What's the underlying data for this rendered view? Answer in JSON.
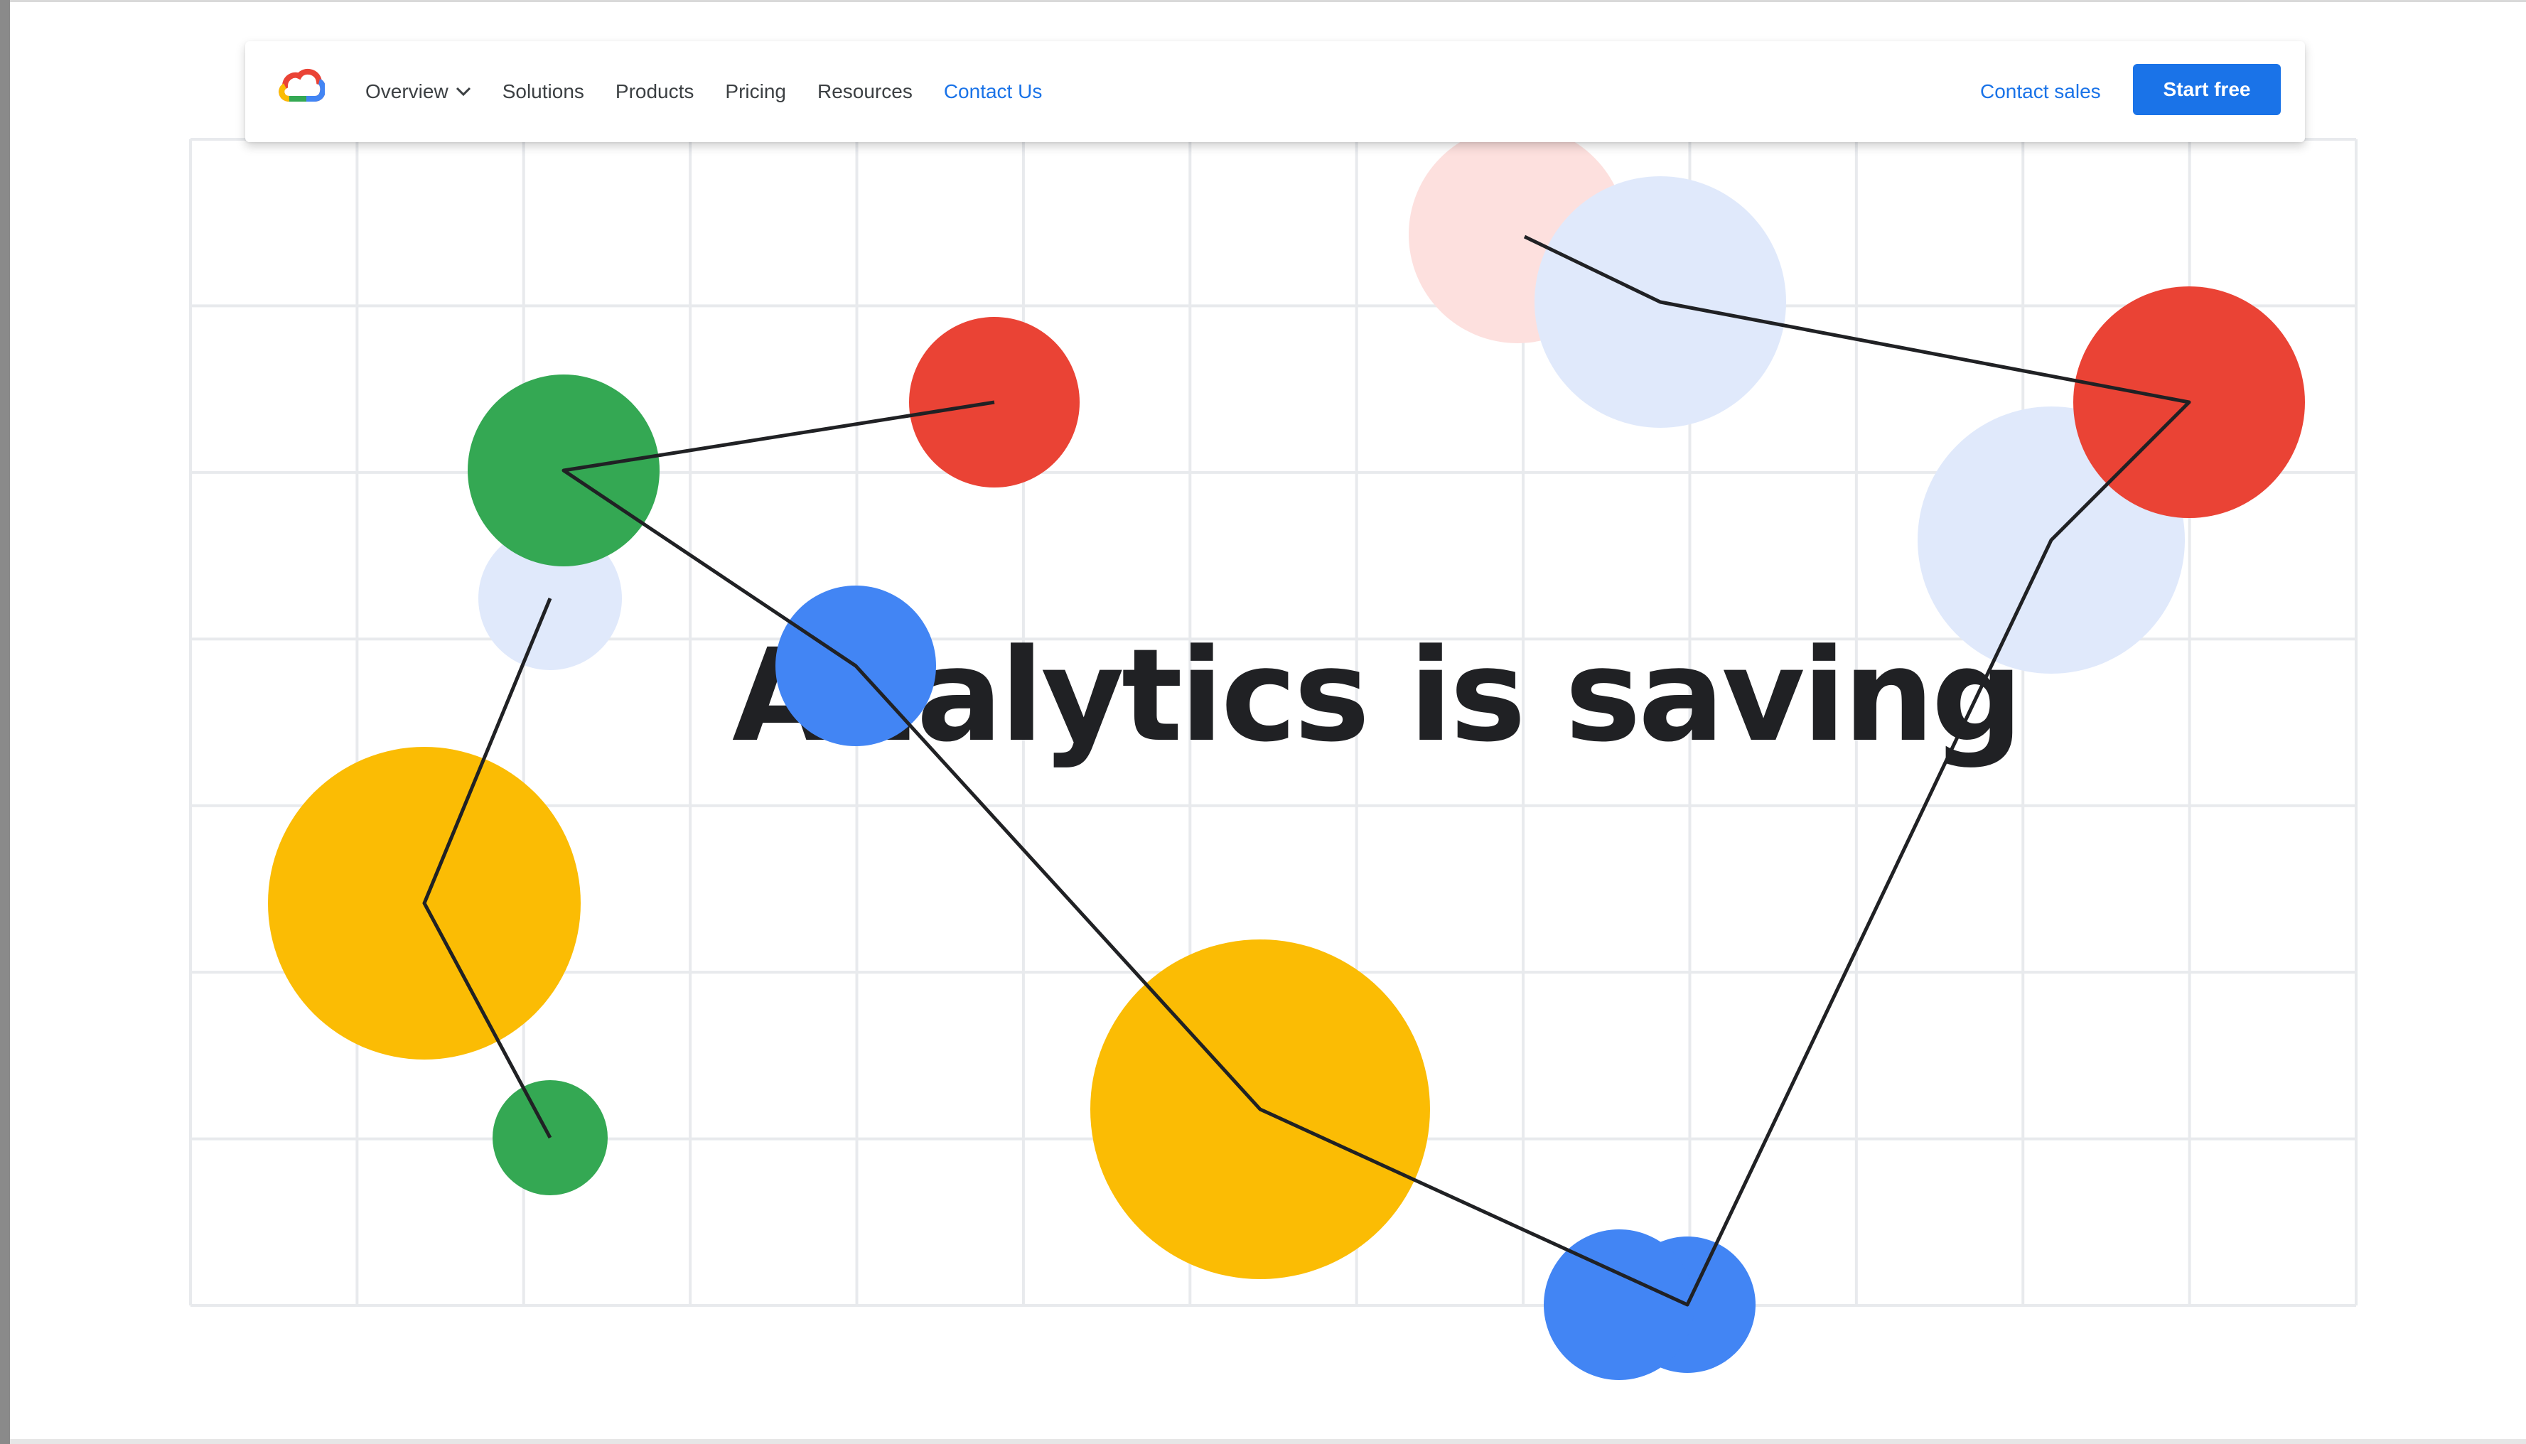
{
  "nav": {
    "logo_icon": "google-cloud-logo-icon",
    "items": [
      {
        "label": "Overview",
        "has_dropdown": true
      },
      {
        "label": "Solutions"
      },
      {
        "label": "Products"
      },
      {
        "label": "Pricing"
      },
      {
        "label": "Resources"
      },
      {
        "label": "Contact Us",
        "active": true
      }
    ],
    "contact_sales": "Contact sales",
    "start_free": "Start free"
  },
  "hero": {
    "headline": "Analytics is saving"
  },
  "colors": {
    "accent_blue": "#1a73e8",
    "google_blue": "#4285f4",
    "google_red": "#ea4335",
    "google_yellow": "#fbbc04",
    "google_green": "#34a853",
    "light_blue": "#e0e9fb",
    "light_pink": "#fde0de",
    "grid_line": "#e8eaed"
  }
}
